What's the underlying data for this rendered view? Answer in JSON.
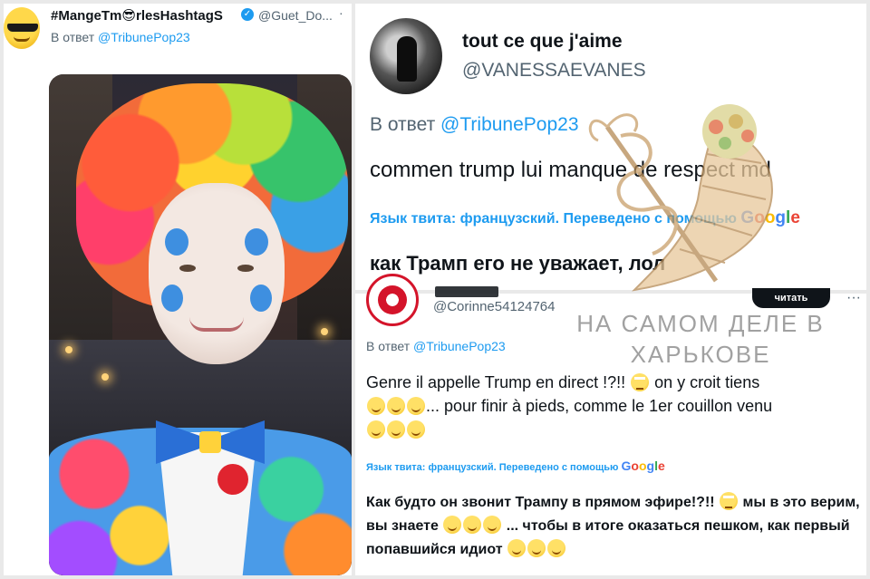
{
  "left_tweet": {
    "author_name": "#MangeTm😎rlesHashtagS",
    "verified": "✓",
    "handle": "@Guet_Do...",
    "more": "·",
    "reply_prefix": "В ответ",
    "reply_mention": "@TribunePop23",
    "avatar_icon": "sunglasses-emoji-icon"
  },
  "top_right_tweet": {
    "author_name": "tout ce que j'aime",
    "handle": "@VANESSAEVANES",
    "reply_prefix": "В ответ",
    "reply_mention": "@TribunePop23",
    "text": "commen trump lui manque de respect md",
    "lang_label": "Язык твита: французский. Переведено с помощью",
    "google_g1": "G",
    "google_o1": "o",
    "google_o2": "o",
    "google_g2": "g",
    "google_l": "l",
    "google_e": "e",
    "translation": "как Трамп его не уважает, лол"
  },
  "bottom_right_tweet": {
    "handle": "@Corinne54124764",
    "follow_label": "читать",
    "more": "···",
    "reply_prefix": "В ответ",
    "reply_mention": "@TribunePop23",
    "text_1": "Genre il appelle Trump en direct !?!! ",
    "text_2": " on y croit tiens ",
    "text_3": "... pour finir à pieds, comme le 1er couillon venu ",
    "lang_label": "Язык твита: французский. Переведено с помощью",
    "google_g1": "G",
    "google_o1": "o",
    "google_o2": "o",
    "google_g2": "g",
    "google_l": "l",
    "google_e": "e",
    "trans_1": "Как будто он звонит Трампу в прямом эфире!?!! ",
    "trans_2": " мы в это верим, вы знаете ",
    "trans_3": " ... чтобы в итоге оказаться пешком, как первый попавшийся идиот "
  },
  "watermark": {
    "line_1": "на самом деле в",
    "line_2": "харькове"
  },
  "colors": {
    "link_blue": "#1d9bf0",
    "muted_gray": "#536471",
    "text_black": "#0f1419"
  }
}
